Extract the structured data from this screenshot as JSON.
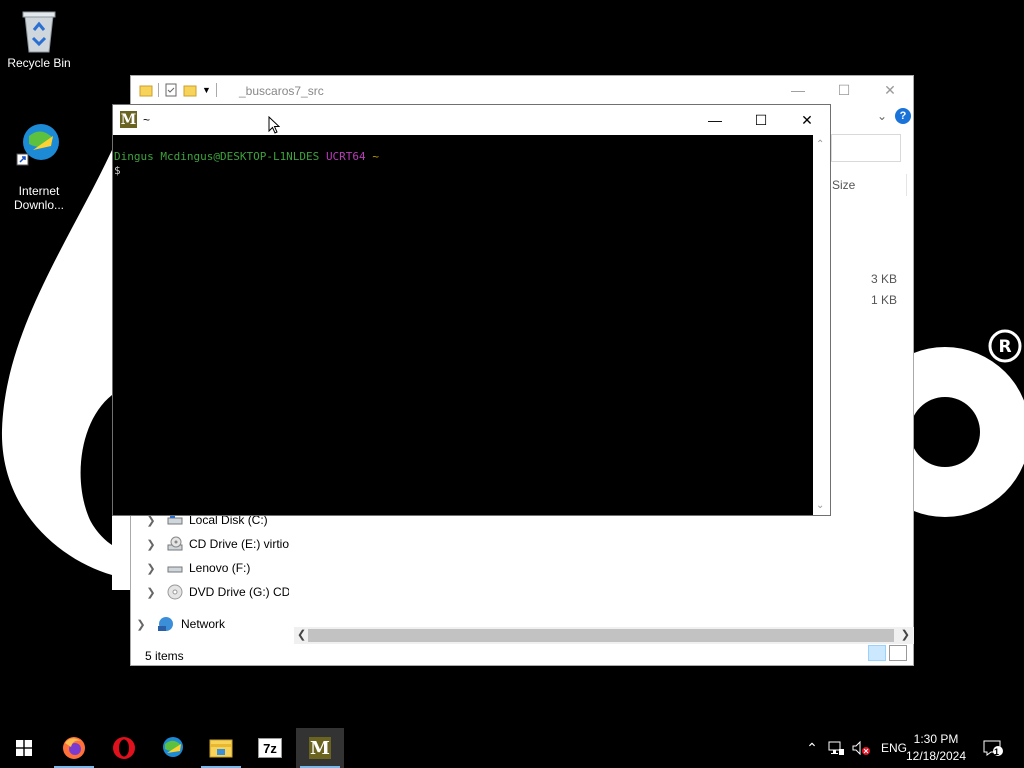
{
  "desktop": {
    "icons": [
      {
        "label": "Recycle Bin",
        "icon": "recycle-bin-icon"
      },
      {
        "label": "Internet\nDownlo...",
        "icon": "internet-download-manager-icon"
      }
    ]
  },
  "explorer": {
    "title": "_buscaros7_src",
    "column_size": "Size",
    "sizes": [
      "3 KB",
      "1 KB"
    ],
    "nav_items": [
      {
        "label": "Local Disk (C:)",
        "icon": "local-disk-icon"
      },
      {
        "label": "CD Drive (E:) virtio-win",
        "icon": "cd-drive-icon"
      },
      {
        "label": "Lenovo (F:)",
        "icon": "drive-icon"
      },
      {
        "label": "DVD Drive (G:) CDROM",
        "icon": "dvd-drive-icon"
      },
      {
        "label": "Network",
        "icon": "network-icon"
      }
    ],
    "status": "5 items",
    "help": "?"
  },
  "terminal": {
    "title": "~",
    "prompt_user": "Dingus Mcdingus@DESKTOP-L1NLDES",
    "prompt_env": "UCRT64",
    "prompt_path": "~",
    "prompt_symbol": "$"
  },
  "taskbar": {
    "apps": [
      "start",
      "firefox",
      "opera",
      "internet-download-manager",
      "file-explorer",
      "7-zip",
      "msys2"
    ],
    "seven_zip_label": "7z",
    "language": "ENG",
    "time": "1:30 PM",
    "date": "12/18/2024",
    "notification_count": "1"
  },
  "colors": {
    "prompt_green": "#3ea23e",
    "prompt_magenta": "#b93cb9",
    "prompt_yellow": "#c4a000",
    "msys2_logo": "#6b6420",
    "taskbar_indicator": "#76b9ed"
  }
}
